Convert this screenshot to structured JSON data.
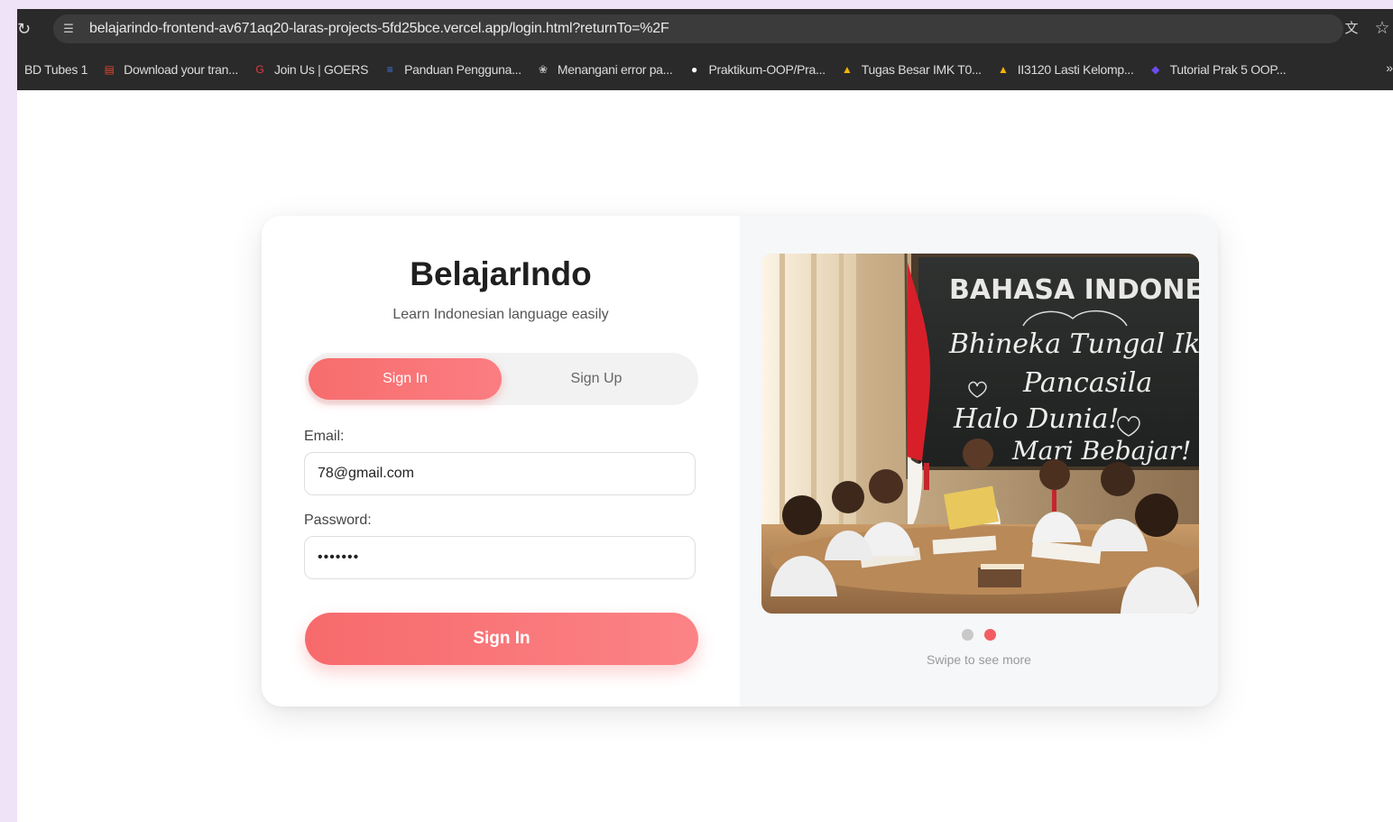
{
  "browser": {
    "url": "belajarindo-frontend-av671aq20-laras-projects-5fd25bce.vercel.app/login.html?returnTo=%2F",
    "icons": [
      "reload-icon",
      "site-info-icon",
      "translate-icon",
      "star-icon"
    ]
  },
  "bookmarks": {
    "items": [
      {
        "label": "BD Tubes 1",
        "icon": "none",
        "color": ""
      },
      {
        "label": "Download your tran...",
        "icon": "document-icon",
        "color": "#e0442f"
      },
      {
        "label": "Join Us | GOERS",
        "icon": "goers-logo-icon",
        "color": "#e23a3a"
      },
      {
        "label": "Panduan Pengguna...",
        "icon": "docs-icon",
        "color": "#3f7be7"
      },
      {
        "label": "Menangani error pa...",
        "icon": "openai-icon",
        "color": "#bdbdbd"
      },
      {
        "label": "Praktikum-OOP/Pra...",
        "icon": "github-icon",
        "color": "#ffffff"
      },
      {
        "label": "Tugas Besar IMK T0...",
        "icon": "drive-icon",
        "color": "#f4b400"
      },
      {
        "label": "II3120 Lasti Kelomp...",
        "icon": "drive-icon",
        "color": "#f4b400"
      },
      {
        "label": "Tutorial Prak 5 OOP...",
        "icon": "app-icon",
        "color": "#6c4cf1"
      }
    ],
    "overflow": "»"
  },
  "login": {
    "brand": "BelajarIndo",
    "tagline": "Learn Indonesian language easily",
    "tabs": {
      "active": "Sign In",
      "inactive": "Sign Up"
    },
    "email_label": "Email:",
    "email_value": "78@gmail.com",
    "password_label": "Password:",
    "password_value": "•••••••",
    "submit_label": "Sign In"
  },
  "carousel": {
    "slide_count": 2,
    "active_index": 1,
    "board": {
      "title": "BAHASA INDONESIA",
      "lines": [
        "Bhineka Tungal Ika",
        "Pancasila",
        "Halo Dunia!",
        "Mari Bebajar!"
      ]
    },
    "hint": "Swipe to see more"
  },
  "colors": {
    "accent": "#f76d6d",
    "dot_active": "#f35c63",
    "dot_inactive": "#c9c9c9"
  }
}
